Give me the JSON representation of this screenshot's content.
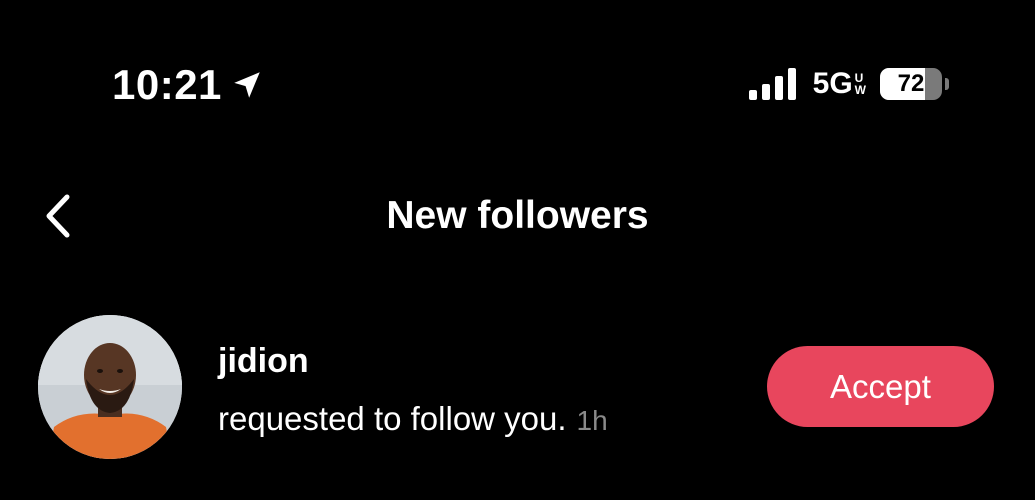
{
  "status_bar": {
    "time": "10:21",
    "network": "5G",
    "network_sub_top": "U",
    "network_sub_bottom": "W",
    "battery_level": "72",
    "battery_fraction": 0.72,
    "icons": [
      "location-arrow-icon",
      "cellular-signal-icon",
      "battery-icon"
    ]
  },
  "header": {
    "back_icon": "chevron-left-icon",
    "title": "New followers"
  },
  "follow_request": {
    "username": "jidion",
    "message": "requested to follow you.",
    "time_ago": "1h",
    "accept_label": "Accept"
  },
  "colors": {
    "background": "#000000",
    "text": "#ffffff",
    "muted_text": "#8a8a8a",
    "accept_button": "#e8465d"
  }
}
